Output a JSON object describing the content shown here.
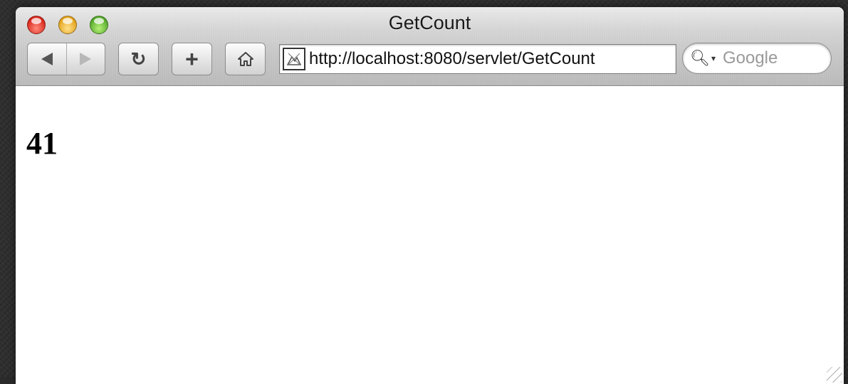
{
  "window": {
    "title": "GetCount"
  },
  "toolbar": {
    "back_icon": "back-arrow-icon",
    "forward_icon": "forward-arrow-icon",
    "reload_glyph": "↻",
    "add_glyph": "+",
    "home_glyph": "⌂"
  },
  "address_bar": {
    "url": "http://localhost:8080/servlet/GetCount"
  },
  "search": {
    "placeholder": "Google"
  },
  "page": {
    "count": "41"
  }
}
